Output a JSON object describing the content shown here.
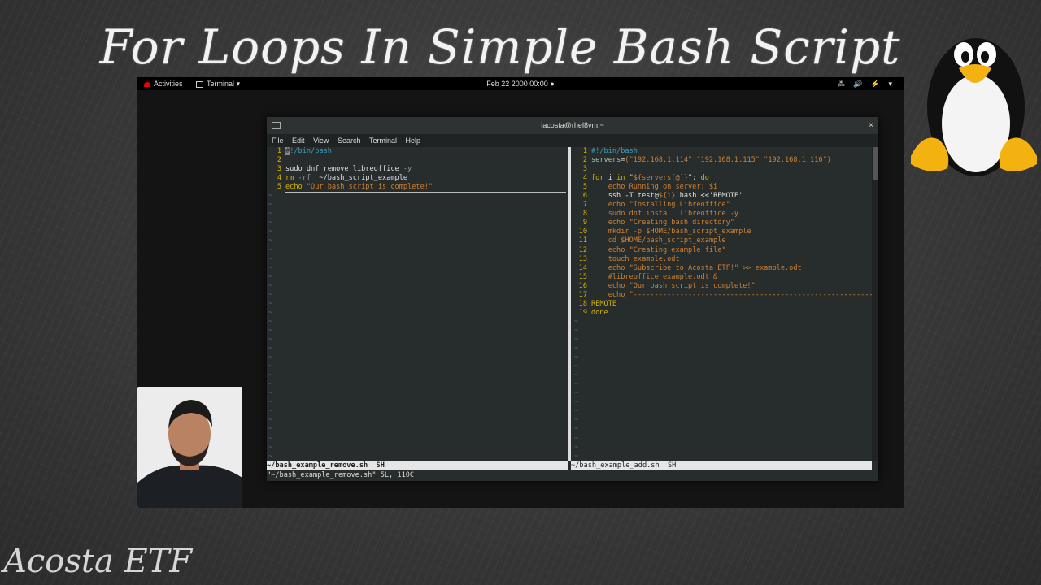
{
  "video": {
    "title": "For Loops In Simple Bash Script",
    "watermark": "Acosta ETF"
  },
  "topbar": {
    "activities": "Activities",
    "app_menu": "Terminal ▾",
    "clock": "Feb 22 2000 00:00 ●",
    "tray": "⁂ 🔊 ⚡ ▾"
  },
  "terminal": {
    "title": "lacosta@rhel8vm:~",
    "close": "×",
    "menu": [
      "File",
      "Edit",
      "View",
      "Search",
      "Terminal",
      "Help"
    ]
  },
  "left_pane": {
    "lines": [
      {
        "n": "1",
        "parts": [
          {
            "c": "cursor",
            "t": "#"
          },
          {
            "c": "c-com",
            "t": "!/bin/bash"
          }
        ]
      },
      {
        "n": "2",
        "parts": []
      },
      {
        "n": "3",
        "parts": [
          {
            "c": "c-txt",
            "t": "sudo dnf remove libreoffice "
          },
          {
            "c": "c-dim",
            "t": "-y"
          }
        ]
      },
      {
        "n": "4",
        "parts": [
          {
            "c": "c-var",
            "t": "rm"
          },
          {
            "c": "c-dim",
            "t": " -rf "
          },
          {
            "c": "c-txt",
            "t": " ~/bash_script_example"
          }
        ]
      },
      {
        "n": "5",
        "parts": [
          {
            "c": "c-var",
            "t": "echo "
          },
          {
            "c": "c-ora",
            "t": "\"Our bash script is complete!\""
          }
        ],
        "current": true
      }
    ],
    "tildes": 30,
    "status": "~/bash_example_remove.sh  SH"
  },
  "right_pane": {
    "lines": [
      {
        "n": "1",
        "parts": [
          {
            "c": "c-com",
            "t": "#!/bin/bash"
          }
        ]
      },
      {
        "n": "2",
        "parts": [
          {
            "c": "c-grn",
            "t": "servers"
          },
          {
            "c": "c-txt",
            "t": "="
          },
          {
            "c": "c-ora",
            "t": "(\"192.168.1.114\" \"192.168.1.115\" \"192.168.1.116\")"
          }
        ]
      },
      {
        "n": "3",
        "parts": []
      },
      {
        "n": "4",
        "parts": [
          {
            "c": "c-var",
            "t": "for"
          },
          {
            "c": "c-txt",
            "t": " i "
          },
          {
            "c": "c-var",
            "t": "in"
          },
          {
            "c": "c-txt",
            "t": " \""
          },
          {
            "c": "c-ora",
            "t": "${servers[@]}"
          },
          {
            "c": "c-txt",
            "t": "\"; "
          },
          {
            "c": "c-var",
            "t": "do"
          }
        ]
      },
      {
        "n": "5",
        "parts": [
          {
            "c": "c-ora",
            "t": "    echo Running on server: $i"
          }
        ]
      },
      {
        "n": "6",
        "parts": [
          {
            "c": "c-txt",
            "t": "    ssh -T test@"
          },
          {
            "c": "c-ora",
            "t": "${i}"
          },
          {
            "c": "c-txt",
            "t": " bash <<'REMOTE'"
          }
        ]
      },
      {
        "n": "7",
        "parts": [
          {
            "c": "c-ora",
            "t": "    echo \"Installing Libreoffice\""
          }
        ]
      },
      {
        "n": "8",
        "parts": [
          {
            "c": "c-ora",
            "t": "    sudo dnf install libreoffice -y"
          }
        ]
      },
      {
        "n": "9",
        "parts": [
          {
            "c": "c-ora",
            "t": "    echo \"Creating bash directory\""
          }
        ]
      },
      {
        "n": "10",
        "parts": [
          {
            "c": "c-ora",
            "t": "    mkdir -p $HOME/bash_script_example"
          }
        ]
      },
      {
        "n": "11",
        "parts": [
          {
            "c": "c-ora",
            "t": "    cd $HOME/bash_script_example"
          }
        ]
      },
      {
        "n": "12",
        "parts": [
          {
            "c": "c-ora",
            "t": "    echo \"Creating example file\""
          }
        ]
      },
      {
        "n": "13",
        "parts": [
          {
            "c": "c-ora",
            "t": "    touch example.odt"
          }
        ]
      },
      {
        "n": "14",
        "parts": [
          {
            "c": "c-ora",
            "t": "    echo \"Subscribe to Acosta ETF!\" >> example.odt"
          }
        ]
      },
      {
        "n": "15",
        "parts": [
          {
            "c": "c-ora",
            "t": "    #libreoffice example.odt &"
          }
        ]
      },
      {
        "n": "16",
        "parts": [
          {
            "c": "c-ora",
            "t": "    echo \"Our bash script is complete!\""
          }
        ]
      },
      {
        "n": "17",
        "parts": [
          {
            "c": "c-ora",
            "t": "    echo \"-------------------------------------------------------------"
          }
        ]
      },
      {
        "n": "18",
        "parts": [
          {
            "c": "c-var",
            "t": "REMOTE"
          }
        ]
      },
      {
        "n": "19",
        "parts": [
          {
            "c": "c-var",
            "t": "done"
          }
        ]
      }
    ],
    "tildes": 16,
    "status": "~/bash_example_add.sh  SH"
  },
  "command_line": "\"~/bash_example_remove.sh\" 5L, 110C"
}
